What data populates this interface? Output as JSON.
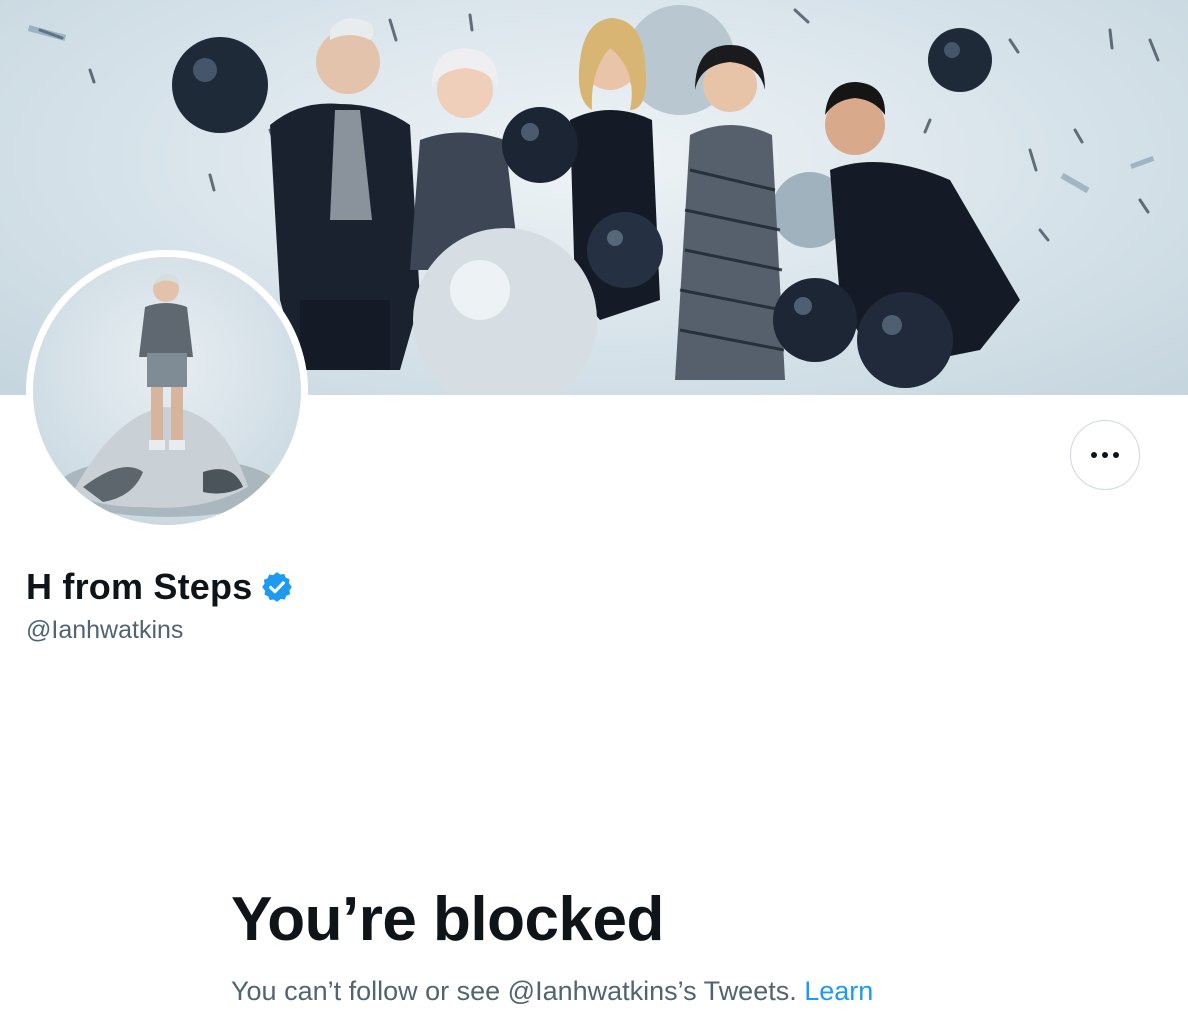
{
  "profile": {
    "display_name": "H from Steps",
    "handle": "@Ianhwatkins",
    "verified": true
  },
  "header": {
    "banner_alt": "Group photo with balloons and confetti",
    "avatar_alt": "Profile photo in silver outfit"
  },
  "actions": {
    "more_icon": "more-horizontal-icon"
  },
  "blocked": {
    "title": "You’re blocked",
    "message": "You can’t follow or see @Ianhwatkins’s Tweets.",
    "learn_link": "Learn"
  },
  "colors": {
    "accent": "#1d9bf0",
    "text_primary": "#0f1419",
    "text_secondary": "#536471",
    "border": "#cfd9de"
  }
}
